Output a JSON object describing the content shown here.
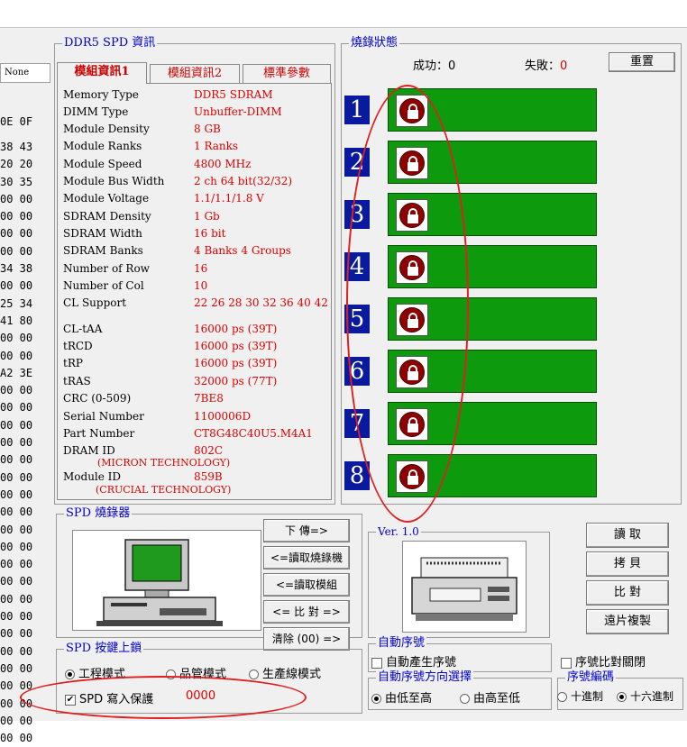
{
  "hex": {
    "none_label": "None",
    "header": "0E 0F",
    "rows": [
      "38 43",
      "20 20",
      "30 35",
      "00 00",
      "00 00",
      "00 00",
      "00 00",
      "34 38",
      "00 00",
      "25 34",
      "41 80",
      "00 00",
      "00 00",
      "A2 3E",
      "00 00",
      "00 00",
      "00 00",
      "00 00",
      "00 00",
      "00 00",
      "00 00",
      "00 00",
      "00 00",
      "00 00",
      "00 00",
      "00 00",
      "00 00",
      "00 00",
      "00 00",
      "00 00",
      "00 00",
      "00 00",
      "00 00",
      "00 00",
      "00 00"
    ]
  },
  "spd_info": {
    "title": "DDR5 SPD 資訊",
    "tabs": [
      "模組資訊1",
      "模組資訊2",
      "標準參數"
    ],
    "rows": [
      {
        "label": "Memory Type",
        "value": "DDR5 SDRAM"
      },
      {
        "label": "DIMM Type",
        "value": "Unbuffer-DIMM"
      },
      {
        "label": "Module Density",
        "value": "8 GB"
      },
      {
        "label": "Module Ranks",
        "value": "1 Ranks"
      },
      {
        "label": "Module Speed",
        "value": "4800 MHz"
      },
      {
        "label": "Module Bus Width",
        "value": "2 ch 64 bit(32/32)"
      },
      {
        "label": "Module Voltage",
        "value": "1.1/1.1/1.8 V"
      },
      {
        "label": "SDRAM Density",
        "value": "1 Gb"
      },
      {
        "label": "SDRAM Width",
        "value": "16 bit"
      },
      {
        "label": "SDRAM Banks",
        "value": "4 Banks 4 Groups"
      },
      {
        "label": "Number of Row",
        "value": "16"
      },
      {
        "label": "Number of Col",
        "value": "10"
      },
      {
        "label": "CL Support",
        "value": "22 26 28 30 32 36 40 42"
      },
      {
        "label": "CL-tAA",
        "value": "16000 ps (39T)"
      },
      {
        "label": "tRCD",
        "value": "16000 ps (39T)"
      },
      {
        "label": "tRP",
        "value": "16000 ps (39T)"
      },
      {
        "label": "tRAS",
        "value": "32000 ps (77T)"
      },
      {
        "label": "CRC (0-509)",
        "value": "7BE8"
      },
      {
        "label": "Serial Number",
        "value": "1100006D"
      },
      {
        "label": "Part Number",
        "value": "CT8G48C40U5.M4A1"
      },
      {
        "label": "DRAM ID",
        "value": "802C"
      },
      {
        "label": "Module  ID",
        "value": "859B"
      }
    ],
    "dram_id_sub": "(MICRON TECHNOLOGY)",
    "module_id_sub": "(CRUCIAL TECHNOLOGY)"
  },
  "burn_status": {
    "title": "燒錄狀態",
    "success_label": "成功：0",
    "fail_label": "失敗：",
    "fail_value": "0",
    "reset_button": "重置",
    "slots": [
      "1",
      "2",
      "3",
      "4",
      "5",
      "6",
      "7",
      "8"
    ],
    "slot_color": "#0d9a0d",
    "lock_icon": "unlock-icon"
  },
  "burner": {
    "title": "SPD 燒錄器",
    "buttons": [
      "下 傳=>",
      "<=讀取燒錄機",
      "<=讀取模組",
      "<= 比 對 =>",
      "清除 (00) =>"
    ]
  },
  "version": {
    "label": "Ver. 1.0"
  },
  "right_buttons": [
    "讀 取",
    "拷 貝",
    "比 對",
    "遠片複製"
  ],
  "lock": {
    "title": "SPD 按鍵上鎖",
    "modes": [
      "工程模式",
      "品管模式",
      "生產線模式"
    ],
    "selected_mode": "工程模式",
    "protect_label": "SPD 寫入保護",
    "protect_checked": true,
    "protect_value": "0000"
  },
  "serial": {
    "auto_title": "自動序號",
    "auto_gen_label": "自動產生序號",
    "compare_close_label": "序號比對關閉",
    "direction_title": "自動序號方向選擇",
    "directions": [
      "由低至高",
      "由高至低"
    ],
    "selected_direction": "由低至高",
    "encoding_title": "序號編碼",
    "encodings": [
      "十進制",
      "十六進制"
    ],
    "selected_encoding": "十六進制"
  },
  "colors": {
    "accent_red": "#e00000",
    "group_title_blue": "#0000cc",
    "slot_number_bg": "#0a1a9e"
  }
}
